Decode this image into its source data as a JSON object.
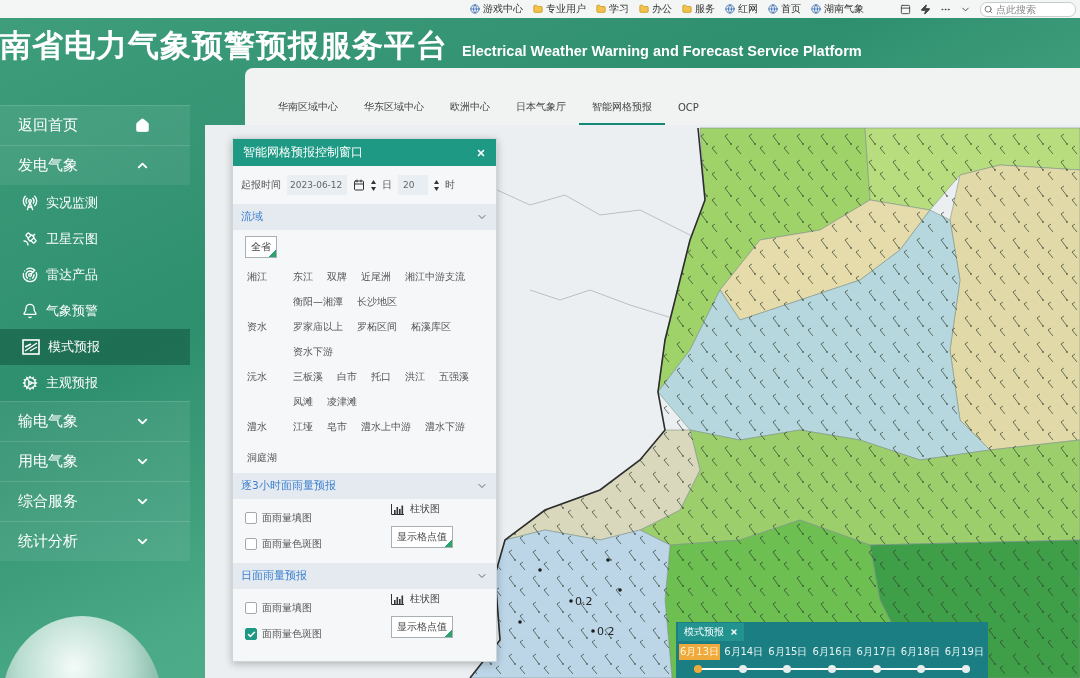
{
  "browser": {
    "bookmarks": [
      {
        "label": "游戏中心",
        "kind": "site"
      },
      {
        "label": "专业用户",
        "kind": "folder"
      },
      {
        "label": "学习",
        "kind": "folder"
      },
      {
        "label": "办公",
        "kind": "folder"
      },
      {
        "label": "服务",
        "kind": "folder"
      },
      {
        "label": "红网",
        "kind": "site"
      },
      {
        "label": "首页",
        "kind": "site"
      },
      {
        "label": "湖南气象",
        "kind": "site"
      }
    ],
    "search": {
      "placeholder": "点此搜索"
    }
  },
  "header": {
    "title": "南省电力气象预警预报服务平台",
    "subtitle": "Electrical Weather Warning and Forecast Service Platform"
  },
  "sidebar": {
    "items": [
      {
        "label": "返回首页",
        "kind": "home"
      },
      {
        "label": "发电气象",
        "kind": "group",
        "expanded": true,
        "children": [
          {
            "label": "实况监测",
            "selected": false
          },
          {
            "label": "卫星云图",
            "selected": false
          },
          {
            "label": "雷达产品",
            "selected": false
          },
          {
            "label": "气象预警",
            "selected": false
          },
          {
            "label": "模式预报",
            "selected": true
          },
          {
            "label": "主观预报",
            "selected": false
          }
        ]
      },
      {
        "label": "输电气象",
        "kind": "group",
        "expanded": false
      },
      {
        "label": "用电气象",
        "kind": "group",
        "expanded": false
      },
      {
        "label": "综合服务",
        "kind": "group",
        "expanded": false
      },
      {
        "label": "统计分析",
        "kind": "group",
        "expanded": false
      }
    ]
  },
  "tabs": [
    {
      "label": "华南区域中心",
      "selected": false
    },
    {
      "label": "华东区域中心",
      "selected": false
    },
    {
      "label": "欧洲中心",
      "selected": false
    },
    {
      "label": "日本气象厅",
      "selected": false
    },
    {
      "label": "智能网格预报",
      "selected": true
    },
    {
      "label": "OCP",
      "selected": false
    }
  ],
  "panel": {
    "title": "智能网格预报控制窗口",
    "start": {
      "label": "起报时间",
      "date": "2023-06-12",
      "day_unit": "日",
      "hour": "20",
      "hour_unit": "时"
    },
    "basin": {
      "title": "流域",
      "all_button": "全省",
      "groups": [
        {
          "name": "湘江",
          "sections": [
            "东江",
            "双牌",
            "近尾洲",
            "湘江中游支流",
            "衡阳—湘潭",
            "长沙地区"
          ]
        },
        {
          "name": "资水",
          "sections": [
            "罗家庙以上",
            "罗柘区间",
            "柘溪库区",
            "资水下游"
          ]
        },
        {
          "name": "沅水",
          "sections": [
            "三板溪",
            "白市",
            "托口",
            "洪江",
            "五强溪",
            "凤滩",
            "凌津滩"
          ]
        },
        {
          "name": "澧水",
          "sections": [
            "江垭",
            "皂市",
            "澧水上中游",
            "澧水下游"
          ]
        },
        {
          "name": "洞庭湖"
        }
      ]
    },
    "forecasts": [
      {
        "title": "逐3小时面雨量预报",
        "options": [
          {
            "label": "面雨量填图",
            "checked": false
          },
          {
            "label": "面雨量色斑图",
            "checked": false
          }
        ],
        "chart_label": "柱状图",
        "grid_button": "显示格点值"
      },
      {
        "title": "日面雨量预报",
        "options": [
          {
            "label": "面雨量填图",
            "checked": false
          },
          {
            "label": "面雨量色斑图",
            "checked": true
          }
        ],
        "chart_label": "柱状图",
        "grid_button": "显示格点值"
      }
    ]
  },
  "map": {
    "labels": [
      "0.2",
      "0.2"
    ]
  },
  "timeline": {
    "title": "模式预报",
    "dates": [
      {
        "label": "6月13日",
        "selected": true
      },
      {
        "label": "6月14日",
        "selected": false
      },
      {
        "label": "6月15日",
        "selected": false
      },
      {
        "label": "6月16日",
        "selected": false
      },
      {
        "label": "6月17日",
        "selected": false
      },
      {
        "label": "6月18日",
        "selected": false
      },
      {
        "label": "6月19日",
        "selected": false
      }
    ]
  }
}
